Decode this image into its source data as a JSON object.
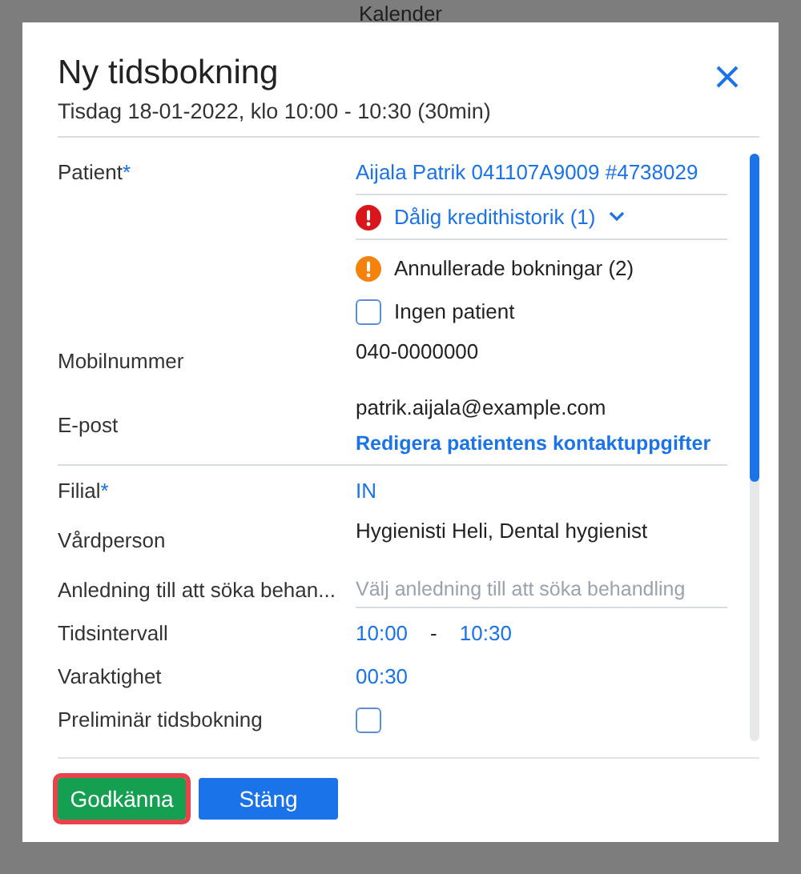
{
  "backdrop": {
    "title": "Kalender"
  },
  "dialog": {
    "title": "Ny tidsbokning",
    "subtitle": "Tisdag 18-01-2022, klo 10:00 - 10:30 (30min)",
    "patient": {
      "label": "Patient",
      "required": "*",
      "value": "Aijala Patrik 041107A9009 #4738029"
    },
    "alerts": [
      {
        "text": "Dålig kredithistorik (1)",
        "color": "#d9161c",
        "expandable": true
      },
      {
        "text": "Annullerade bokningar (2)",
        "color": "#f5820d",
        "expandable": false
      }
    ],
    "no_patient": {
      "label": "Ingen patient",
      "checked": false
    },
    "sections": [
      {
        "fields": [
          {
            "kind": "text",
            "label": "Mobilnummer",
            "value": "040-0000000"
          },
          {
            "kind": "text",
            "label": "E-post",
            "value": "patrik.aijala@example.com",
            "action": "Redigera patientens kontaktuppgifter"
          }
        ]
      },
      {
        "fields": [
          {
            "kind": "link",
            "label": "Filial",
            "required": "*",
            "value": "IN"
          },
          {
            "kind": "text",
            "label": "Vårdperson",
            "value": "Hygienisti Heli, Dental hygienist"
          },
          {
            "kind": "select",
            "label": "Anledning till att söka behan...",
            "placeholder": "Välj anledning till att söka behandling"
          },
          {
            "kind": "range",
            "label": "Tidsintervall",
            "from": "10:00",
            "separator": "-",
            "to": "10:30"
          },
          {
            "kind": "link",
            "label": "Varaktighet",
            "value": "00:30"
          },
          {
            "kind": "checkbox",
            "label": "Preliminär tidsbokning",
            "checked": false
          }
        ]
      }
    ],
    "buttons": [
      {
        "label": "Godkänna",
        "kind": "success",
        "highlighted": true
      },
      {
        "label": "Stäng",
        "kind": "primary",
        "highlighted": false
      }
    ]
  }
}
